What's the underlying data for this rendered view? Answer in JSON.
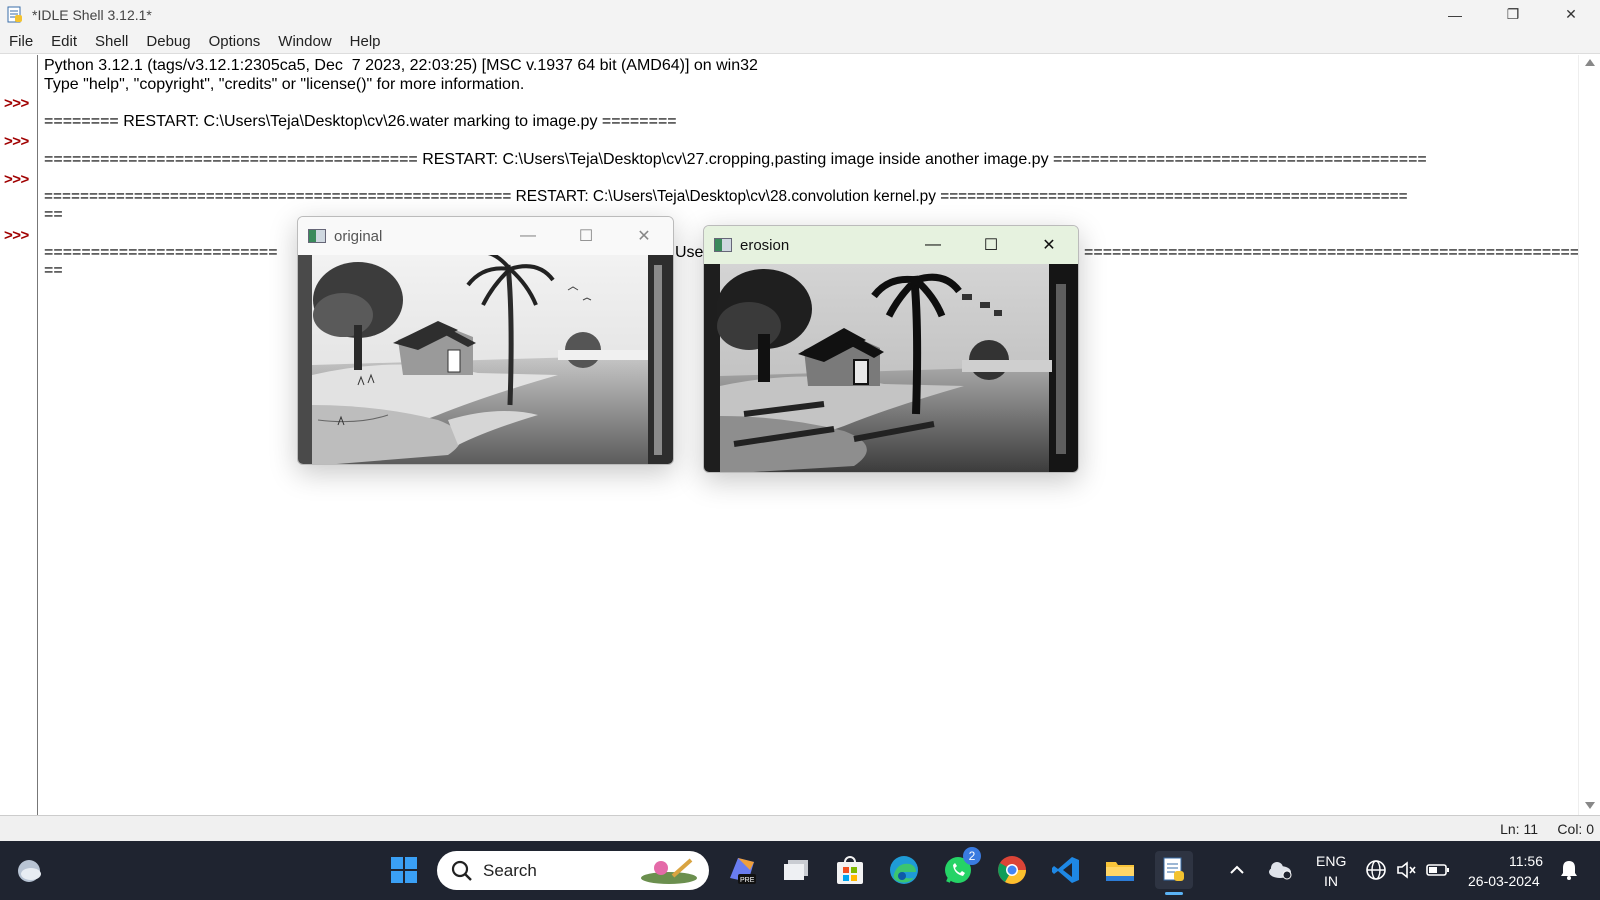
{
  "window": {
    "title": "*IDLE Shell 3.12.1*",
    "controls": {
      "minimize": "—",
      "restore": "❐",
      "close": "✕"
    }
  },
  "menubar": [
    "File",
    "Edit",
    "Shell",
    "Debug",
    "Options",
    "Window",
    "Help"
  ],
  "shell": {
    "prompt": ">>>",
    "lines": [
      "Python 3.12.1 (tags/v3.12.1:2305ca5, Dec  7 2023, 22:03:25) [MSC v.1937 64 bit (AMD64)] on win32",
      "Type \"help\", \"copyright\", \"credits\" or \"license()\" for more information.",
      "======== RESTART: C:\\Users\\Teja\\Desktop\\cv\\26.water marking to image.py ========",
      "======================================== RESTART: C:\\Users\\Teja\\Desktop\\cv\\27.cropping,pasting image inside another image.py ========================================",
      "==================================================== RESTART: C:\\Users\\Teja\\Desktop\\cv\\28.convolution kernel.py ====================================================",
      "==",
      "=========================",
      "Use",
      "=======================================================",
      "=="
    ]
  },
  "statusbar": {
    "line": "Ln: 11",
    "col": "Col: 0"
  },
  "cv_windows": {
    "original": {
      "title": "original"
    },
    "erosion": {
      "title": "erosion"
    }
  },
  "taskbar": {
    "search_label": "Search",
    "whatsapp_badge": "2",
    "language": "ENG",
    "region": "IN",
    "time": "11:56",
    "date": "26-03-2024"
  },
  "colors": {
    "prompt": "#a00000",
    "taskbar": "#1f2430",
    "erosion_titlebar": "#e6f2df"
  }
}
